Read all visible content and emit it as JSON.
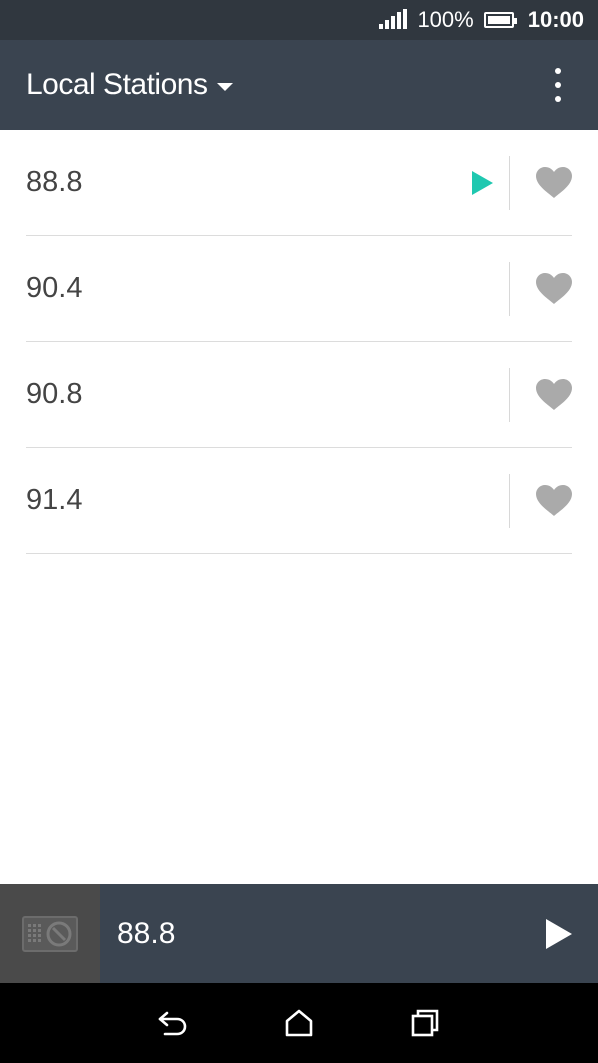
{
  "status_bar": {
    "battery_percent": "100%",
    "time": "10:00"
  },
  "app_bar": {
    "title": "Local Stations"
  },
  "stations": [
    {
      "frequency": "88.8",
      "playing": true
    },
    {
      "frequency": "90.4",
      "playing": false
    },
    {
      "frequency": "90.8",
      "playing": false
    },
    {
      "frequency": "91.4",
      "playing": false
    }
  ],
  "now_playing": {
    "frequency": "88.8"
  },
  "colors": {
    "status_bar_bg": "#30373f",
    "app_bar_bg": "#3a4450",
    "accent_play": "#1fc8b0",
    "heart_gray": "#aaaaaa",
    "nav_bar_bg": "#000000"
  },
  "icons": {
    "dropdown": "caret-down-icon",
    "menu": "overflow-menu-icon",
    "favorite": "heart-icon",
    "play": "play-icon",
    "back": "back-icon",
    "home": "home-icon",
    "recents": "recents-icon"
  }
}
